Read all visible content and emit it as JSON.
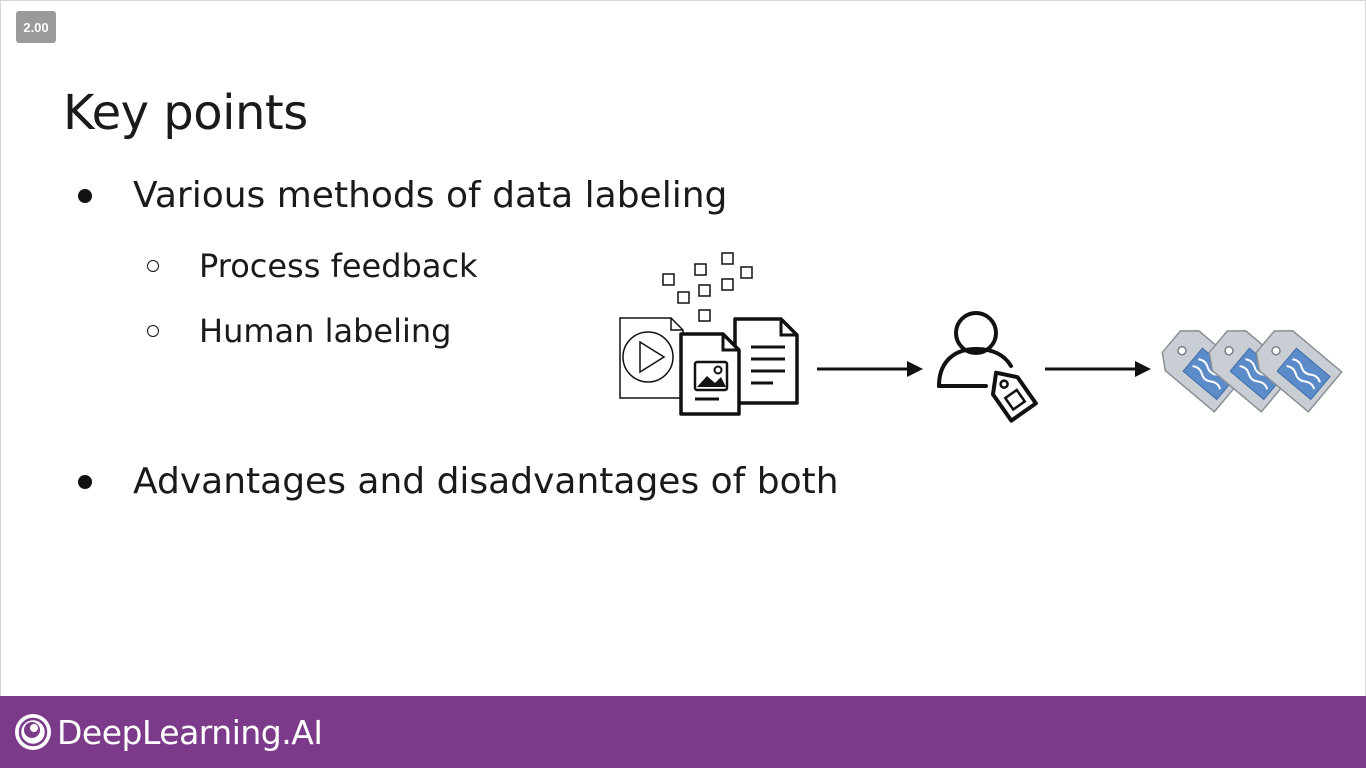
{
  "player": {
    "speed_badge": "2.00"
  },
  "slide": {
    "title": "Key points",
    "bullets": [
      {
        "text": "Various methods of data labeling",
        "sub": [
          {
            "text": "Process feedback"
          },
          {
            "text": "Human labeling"
          }
        ]
      },
      {
        "text": "Advantages and disadvantages of both"
      }
    ],
    "diagram": {
      "icons": [
        "scattered-data-squares-icon",
        "media-documents-icon",
        "arrow-right-icon",
        "person-with-tag-icon",
        "arrow-right-icon",
        "labeled-tags-icon"
      ],
      "tag_color": "#5b8bc9"
    }
  },
  "footer": {
    "brand": "DeepLearning.AI",
    "background": "#7b3b8a"
  }
}
